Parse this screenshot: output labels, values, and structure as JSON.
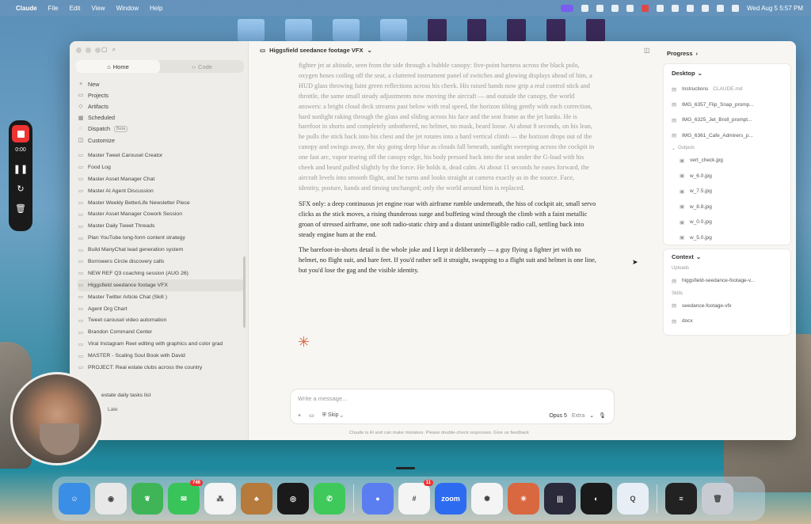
{
  "menubar": {
    "app": "Claude",
    "menus": [
      "File",
      "Edit",
      "View",
      "Window",
      "Help"
    ],
    "clock": "Wed Aug 5  5:57 PM"
  },
  "recorder": {
    "time": "0:00"
  },
  "sidebar": {
    "toggle": {
      "home": "Home",
      "code": "Code"
    },
    "nav": [
      {
        "icon": "plus-icon",
        "glyph": "+",
        "label": "New"
      },
      {
        "icon": "folder-icon",
        "glyph": "▭",
        "label": "Projects"
      },
      {
        "icon": "artifacts-icon",
        "glyph": "◇",
        "label": "Artifacts"
      },
      {
        "icon": "calendar-icon",
        "glyph": "▦",
        "label": "Scheduled"
      },
      {
        "icon": "dispatch-icon",
        "glyph": "◌",
        "label": "Dispatch",
        "badge": "Beta"
      },
      {
        "icon": "customize-icon",
        "glyph": "◫",
        "label": "Customize"
      }
    ],
    "conversations": [
      "Master Tweet Carousel Creator",
      "Food Log",
      "Master Asset Manager Chat",
      "Master AI Agent Discussion",
      "Master Weekly BetterLife Newsletter Piece",
      "Master Asset Manager Cowork Session",
      "Master Daily Tweet Threads",
      "Plan YouTube long-form content strategy",
      "Build ManyChat lead generation system",
      "Borrowers Circle discovery calls",
      "NEW REF Q3 coaching session (AUG 26)",
      "Higgsfield seedance footage VFX",
      "Master Twitter Article Chat (Skill )",
      "Agent Org Chart",
      "Tweet carousel video automation",
      "Brandon Command Center",
      "Viral Instagram Reel editing with graphics and color grad",
      "MASTER - Scaling Soul Book with David",
      "PROJECT: Real estate clubs across the country"
    ],
    "bottom_item": "estate daily tasks list",
    "bottom_status": "Late"
  },
  "chat": {
    "title": "Higgsfield seedance footage VFX",
    "paragraphs": [
      "fighter jet at altitude, seen from the side through a bubble canopy: five-point harness across the black polo, oxygen hoses coiling off the seat, a cluttered instrument panel of switches and glowing displays ahead of him, a HUD glass throwing faint green reflections across his cheek. His raised hands now grip a real control stick and throttle, the same small steady adjustments now moving the aircraft — and outside the canopy, the world answers: a bright cloud deck streams past below with real speed, the horizon tilting gently with each correction, hard sunlight raking through the glass and sliding across his face and the seat frame as the jet banks. He is barefoot in shorts and completely unbothered, no helmet, no mask, beard loose. At about 8 seconds, on his lean, he pulls the stick back into his chest and the jet rotates into a hard vertical climb — the horizon drops out of the canopy and swings away, the sky going deep blue as clouds fall beneath, sunlight sweeping across the cockpit in one fast arc, vapor tearing off the canopy edge, his body pressed back into the seat under the G-load with his cheek and beard pulled slightly by the force. He holds it, dead calm. At about 11 seconds he eases forward, the aircraft levels into smooth flight, and he turns and looks straight at camera exactly as in the source. Face, identity, posture, hands and timing unchanged; only the world around him is replaced.",
      "SFX only: a deep continuous jet engine roar with airframe rumble underneath, the hiss of cockpit air, small servo clicks as the stick moves, a rising thunderous surge and buffeting wind through the climb with a faint metallic groan of stressed airframe, one soft radio-static chirp and a distant unintelligible radio call, settling back into steady engine hum at the end.",
      "The barefoot-in-shorts detail is the whole joke and I kept it deliberately — a guy flying a fighter jet with no helmet, no flight suit, and bare feet. If you'd rather sell it straight, swapping to a flight suit and helmet is one line, but you'd lose the gag and the visible identity."
    ],
    "composer_placeholder": "Write a message...",
    "skip_label": "Skip",
    "model_label": "Opus 5",
    "effort_label": "Extra",
    "disclaimer": "Claude is AI and can make mistakes. Please double-check responses. Give us feedback"
  },
  "right_panel": {
    "progress_label": "Progress",
    "desktop_label": "Desktop",
    "files": [
      {
        "name": "Instructions",
        "sub": "CLAUDE.md"
      },
      {
        "name": "IMG_6357_Flip_Snap_promp...",
        "sub": ""
      },
      {
        "name": "IMG_6325_Jet_Broll_prompt...",
        "sub": ""
      },
      {
        "name": "IMG_6361_Cafe_Admirers_p...",
        "sub": ""
      }
    ],
    "outputs_label": "Outputs",
    "outputs": [
      "vert_check.jpg",
      "w_6.0.jpg",
      "w_7.5.jpg",
      "w_8.8.jpg",
      "w_0.0.jpg",
      "w_5.0.jpg"
    ],
    "context_label": "Context",
    "uploads_label": "Uploads",
    "uploads": [
      "higgsfield-seedance-footage-v..."
    ],
    "skills_label": "Skills",
    "skills": [
      "seedance-footage-vfx",
      "docx"
    ]
  },
  "dock": {
    "apps": [
      {
        "name": "finder",
        "color": "#3a8ee6",
        "glyph": "☺"
      },
      {
        "name": "chrome",
        "color": "#e8e8e8",
        "glyph": "◉"
      },
      {
        "name": "evernote",
        "color": "#3fb558",
        "glyph": "❦"
      },
      {
        "name": "messages",
        "color": "#39c45a",
        "glyph": "✉",
        "badge": "746"
      },
      {
        "name": "asana",
        "color": "#f4f4f4",
        "glyph": "⁂"
      },
      {
        "name": "game",
        "color": "#b57a3c",
        "glyph": "♣"
      },
      {
        "name": "spotify",
        "color": "#1a1a1a",
        "glyph": "◎"
      },
      {
        "name": "whatsapp",
        "color": "#3fc95a",
        "glyph": "✆"
      },
      {
        "name": "screenpal",
        "color": "#5a7ef0",
        "glyph": "●"
      },
      {
        "name": "slack",
        "color": "#f4f4f4",
        "glyph": "#",
        "badge": "11"
      },
      {
        "name": "zoom",
        "color": "#2d6cf0",
        "glyph": "zoom"
      },
      {
        "name": "chatgpt",
        "color": "#f4f4f4",
        "glyph": "✺"
      },
      {
        "name": "claude",
        "color": "#d9673f",
        "glyph": "✳"
      },
      {
        "name": "audio",
        "color": "#2a2a3a",
        "glyph": "|||"
      },
      {
        "name": "copilot",
        "color": "#1a1a1a",
        "glyph": "◐"
      },
      {
        "name": "quicktime",
        "color": "#e8eef6",
        "glyph": "Q"
      },
      {
        "name": "notes",
        "color": "#222",
        "glyph": "≡"
      },
      {
        "name": "trash",
        "color": "#c8ccd2",
        "glyph": "🗑"
      }
    ]
  }
}
